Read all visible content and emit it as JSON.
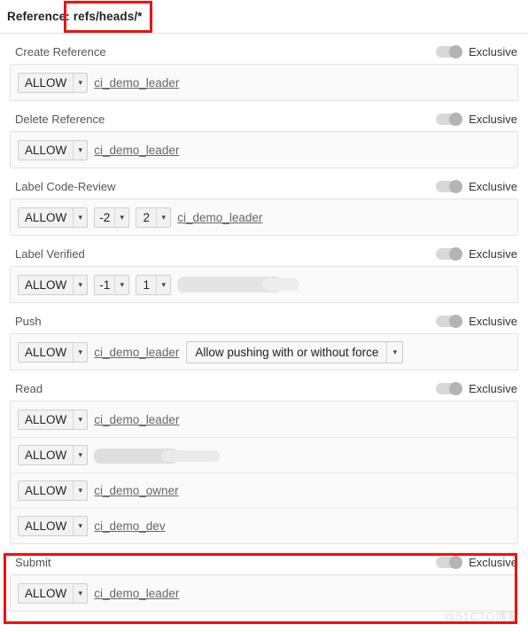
{
  "header": {
    "reference_label": "Reference:",
    "reference_value": "refs/heads/*"
  },
  "common": {
    "exclusive_label": "Exclusive",
    "allow_label": "ALLOW",
    "dropdown_arrow": "▾"
  },
  "sections": [
    {
      "title": "Create Reference",
      "exclusive": "Exclusive",
      "rows": [
        {
          "action": "ALLOW",
          "group": "ci_demo_leader"
        }
      ]
    },
    {
      "title": "Delete Reference",
      "exclusive": "Exclusive",
      "rows": [
        {
          "action": "ALLOW",
          "group": "ci_demo_leader"
        }
      ]
    },
    {
      "title": "Label Code-Review",
      "exclusive": "Exclusive",
      "rows": [
        {
          "action": "ALLOW",
          "min": "-2",
          "max": "2",
          "group": "ci_demo_leader"
        }
      ]
    },
    {
      "title": "Label Verified",
      "exclusive": "Exclusive",
      "rows": [
        {
          "action": "ALLOW",
          "min": "-1",
          "max": "1",
          "group": ""
        }
      ]
    },
    {
      "title": "Push",
      "exclusive": "Exclusive",
      "rows": [
        {
          "action": "ALLOW",
          "group": "ci_demo_leader",
          "force_option": "Allow pushing with or without force"
        }
      ]
    },
    {
      "title": "Read",
      "exclusive": "Exclusive",
      "rows": [
        {
          "action": "ALLOW",
          "group": "ci_demo_leader"
        },
        {
          "action": "ALLOW",
          "group": ""
        },
        {
          "action": "ALLOW",
          "group": "ci_demo_owner"
        },
        {
          "action": "ALLOW",
          "group": "ci_demo_dev"
        }
      ]
    },
    {
      "title": "Submit",
      "exclusive": "Exclusive",
      "rows": [
        {
          "action": "ALLOW",
          "group": "ci_demo_leader"
        }
      ]
    }
  ],
  "annotations": {
    "color": "#ee1111",
    "boxes": [
      "reference-value",
      "submit-section"
    ]
  },
  "watermark": "@51CTO博客"
}
